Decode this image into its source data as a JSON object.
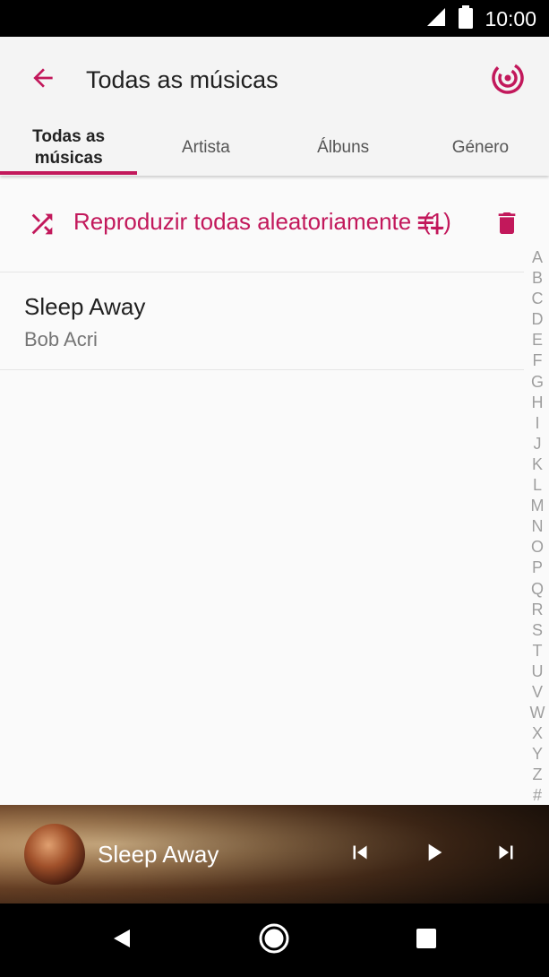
{
  "status_bar": {
    "time": "10:00",
    "signal_icon": "cell-signal-icon",
    "battery_icon": "battery-icon"
  },
  "header": {
    "title": "Todas as músicas",
    "back_icon": "arrow-back-icon",
    "radio_icon": "radio-icon"
  },
  "tabs": [
    {
      "label": "Todas as\nmúsicas",
      "active": true
    },
    {
      "label": "Artista",
      "active": false
    },
    {
      "label": "Álbuns",
      "active": false
    },
    {
      "label": "Género",
      "active": false
    }
  ],
  "shuffle": {
    "label": "Reproduzir todas aleatoriamente",
    "count": "(1)",
    "icon": "shuffle-icon",
    "queue_icon": "playlist-add-icon",
    "delete_icon": "trash-icon"
  },
  "songs": [
    {
      "title": "Sleep Away",
      "artist": "Bob Acri"
    }
  ],
  "alphabet_index": [
    "A",
    "B",
    "C",
    "D",
    "E",
    "F",
    "G",
    "H",
    "I",
    "J",
    "K",
    "L",
    "M",
    "N",
    "O",
    "P",
    "Q",
    "R",
    "S",
    "T",
    "U",
    "V",
    "W",
    "X",
    "Y",
    "Z",
    "#"
  ],
  "mini_player": {
    "title": "Sleep Away",
    "prev_icon": "skip-previous-icon",
    "play_icon": "play-icon",
    "next_icon": "skip-next-icon"
  },
  "nav_bar": {
    "back": "nav-back-icon",
    "home": "nav-home-icon",
    "recents": "nav-recents-icon"
  },
  "colors": {
    "accent": "#c2185b",
    "status_bar": "#000000",
    "app_bar": "#f4f4f4"
  }
}
